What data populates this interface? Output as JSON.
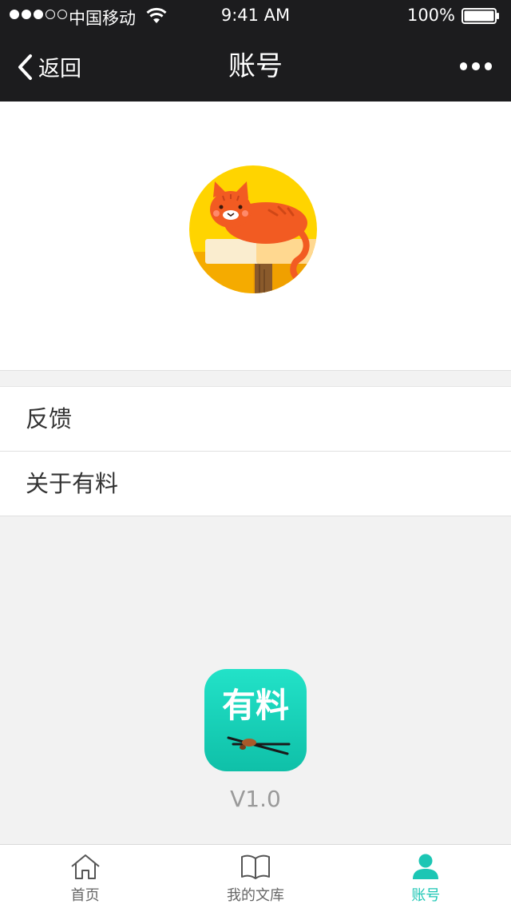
{
  "status_bar": {
    "carrier": "中国移动",
    "time": "9:41 AM",
    "battery": "100%"
  },
  "nav": {
    "back_label": "返回",
    "title": "账号"
  },
  "menu": {
    "items": [
      {
        "label": "反馈"
      },
      {
        "label": "关于有料"
      }
    ]
  },
  "app": {
    "logo_text": "有料",
    "version": "V1.0"
  },
  "tabbar": {
    "items": [
      {
        "label": "首页",
        "icon": "home-icon"
      },
      {
        "label": "我的文库",
        "icon": "book-icon"
      },
      {
        "label": "账号",
        "icon": "user-icon"
      }
    ],
    "active_index": 2
  },
  "colors": {
    "nav_bg": "#1c1c1e",
    "accent": "#1cc6b4",
    "page_bg": "#f2f2f2"
  }
}
